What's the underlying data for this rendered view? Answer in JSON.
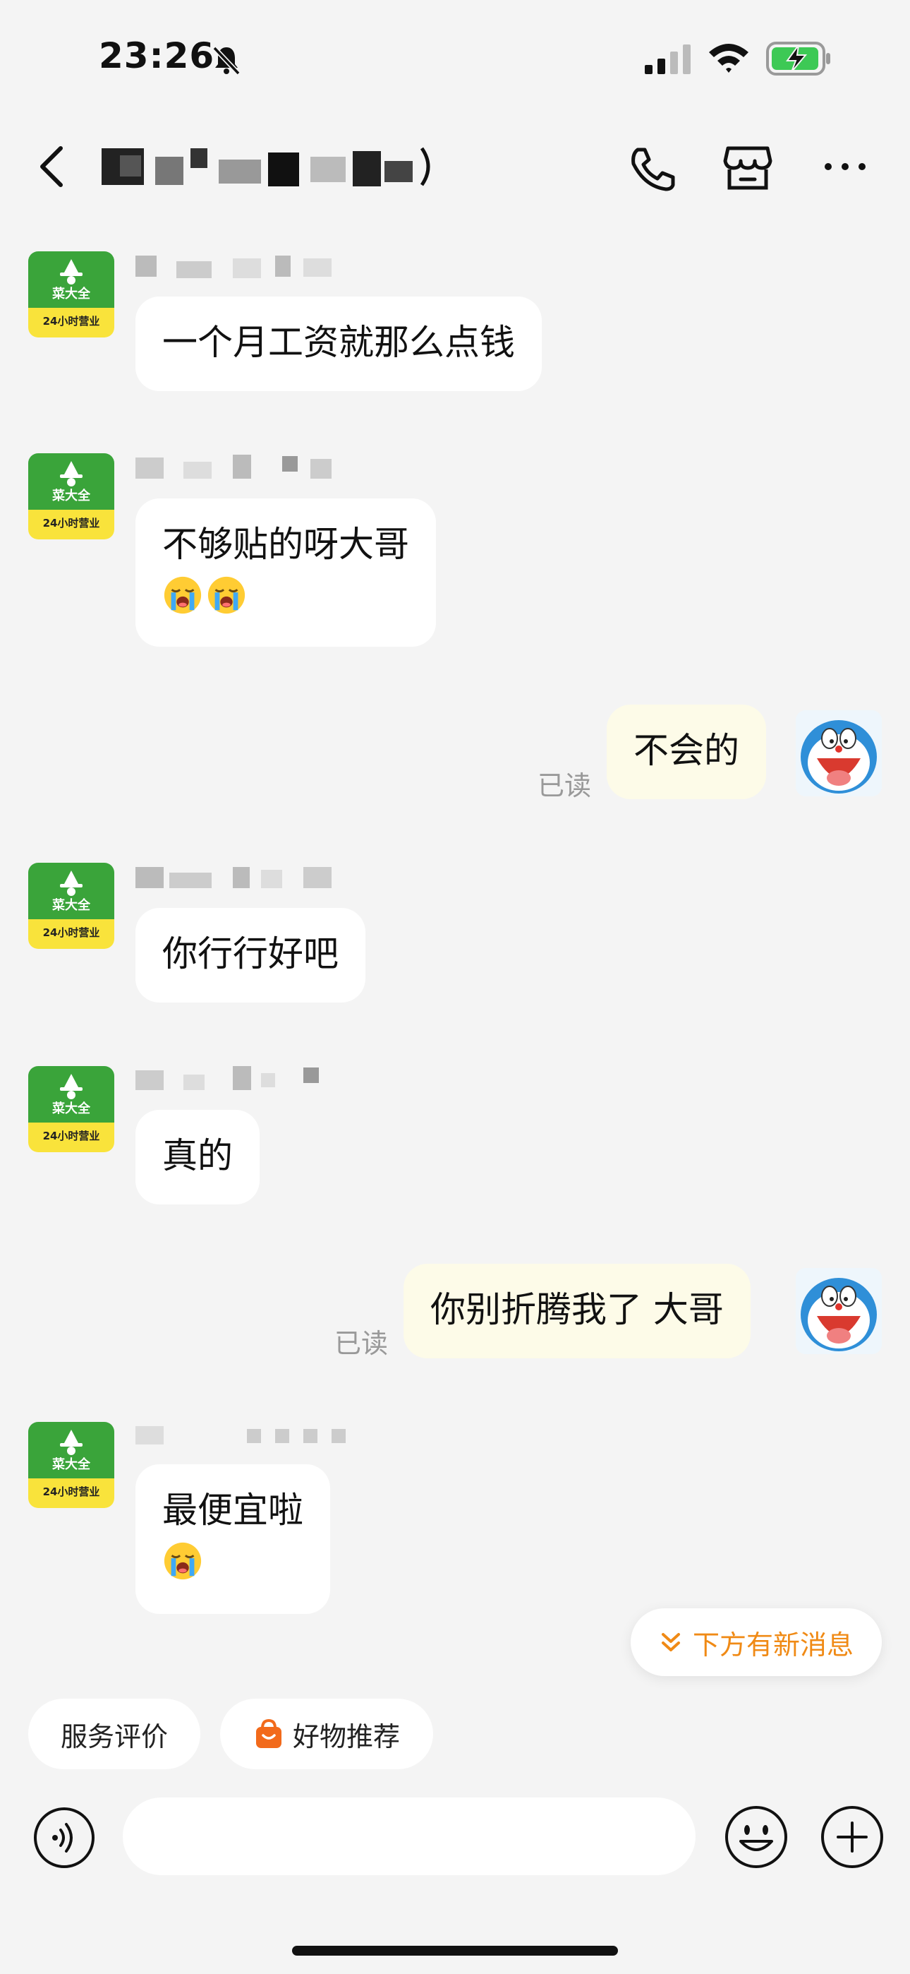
{
  "status_bar": {
    "time": "23:26"
  },
  "header": {
    "title_blurred": true
  },
  "messages": [
    {
      "from": "shop",
      "text": "一个月工资就那么点钱"
    },
    {
      "from": "shop",
      "text": "不够贴的呀大哥",
      "emoji": [
        "crying-face",
        "crying-face"
      ]
    },
    {
      "from": "me",
      "text": "不会的",
      "status": "已读"
    },
    {
      "from": "shop",
      "text": "你行行好吧"
    },
    {
      "from": "shop",
      "text": "真的"
    },
    {
      "from": "me",
      "text": "你别折腾我了 大哥",
      "status": "已读"
    },
    {
      "from": "shop",
      "text": "最便宜啦",
      "emoji": [
        "crying-face"
      ]
    }
  ],
  "shop_avatar": {
    "name": "菜大全",
    "hours": "24小时营业"
  },
  "new_message_notice": {
    "label": "下方有新消息"
  },
  "quick_actions": {
    "review": "服务评价",
    "recommend": "好物推荐"
  },
  "input": {
    "placeholder": "",
    "value": ""
  },
  "colors": {
    "accent": "#f08a15",
    "shop_green": "#3aa43a",
    "shop_yellow": "#f9e33b",
    "my_bubble": "#fdfbe8"
  }
}
